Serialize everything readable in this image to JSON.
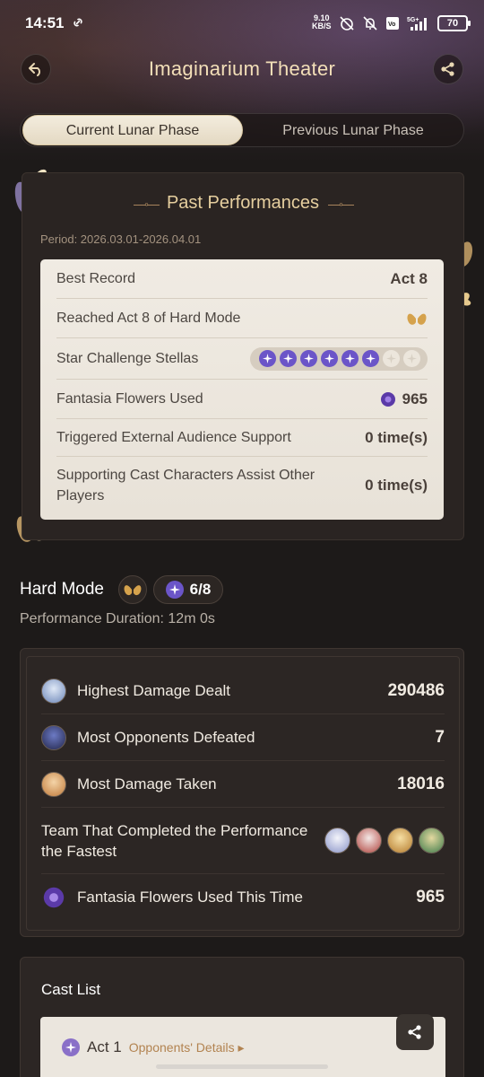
{
  "status_bar": {
    "time": "14:51",
    "speed_value": "9.10",
    "speed_unit": "KB/S",
    "battery": "70"
  },
  "header": {
    "title": "Imaginarium Theater"
  },
  "tabs": [
    {
      "label": "Current Lunar Phase",
      "active": true
    },
    {
      "label": "Previous Lunar Phase",
      "active": false
    }
  ],
  "past_performances": {
    "heading": "Past Performances",
    "period": "Period: 2026.03.01-2026.04.01",
    "rows": {
      "best_record": {
        "label": "Best Record",
        "value": "Act 8"
      },
      "reached": {
        "label": "Reached Act 8 of Hard Mode"
      },
      "stellas": {
        "label": "Star Challenge Stellas",
        "earned": 6,
        "total": 8
      },
      "flowers": {
        "label": "Fantasia Flowers Used",
        "value": "965"
      },
      "external": {
        "label": "Triggered External Audience Support",
        "value": "0 time(s)"
      },
      "assist": {
        "label": "Supporting Cast Characters Assist Other Players",
        "value": "0 time(s)"
      }
    }
  },
  "hard_mode": {
    "title": "Hard Mode",
    "stars": "6/8",
    "duration": "Performance Duration: 12m 0s"
  },
  "stats": {
    "highest_damage": {
      "label": "Highest Damage Dealt",
      "value": "290486"
    },
    "most_defeated": {
      "label": "Most Opponents Defeated",
      "value": "7"
    },
    "most_taken": {
      "label": "Most Damage Taken",
      "value": "18016"
    },
    "fastest_team": {
      "label": "Team That Completed the Performance the Fastest"
    },
    "flowers_this_time": {
      "label": "Fantasia Flowers Used This Time",
      "value": "965"
    }
  },
  "cast_list": {
    "title": "Cast List",
    "act_label": "Act 1",
    "opponents_link": "Opponents' Details"
  },
  "colors": {
    "accent_gold": "#e6cf9f",
    "stella_purple": "#6b55c8",
    "background": "#1d1a19"
  }
}
